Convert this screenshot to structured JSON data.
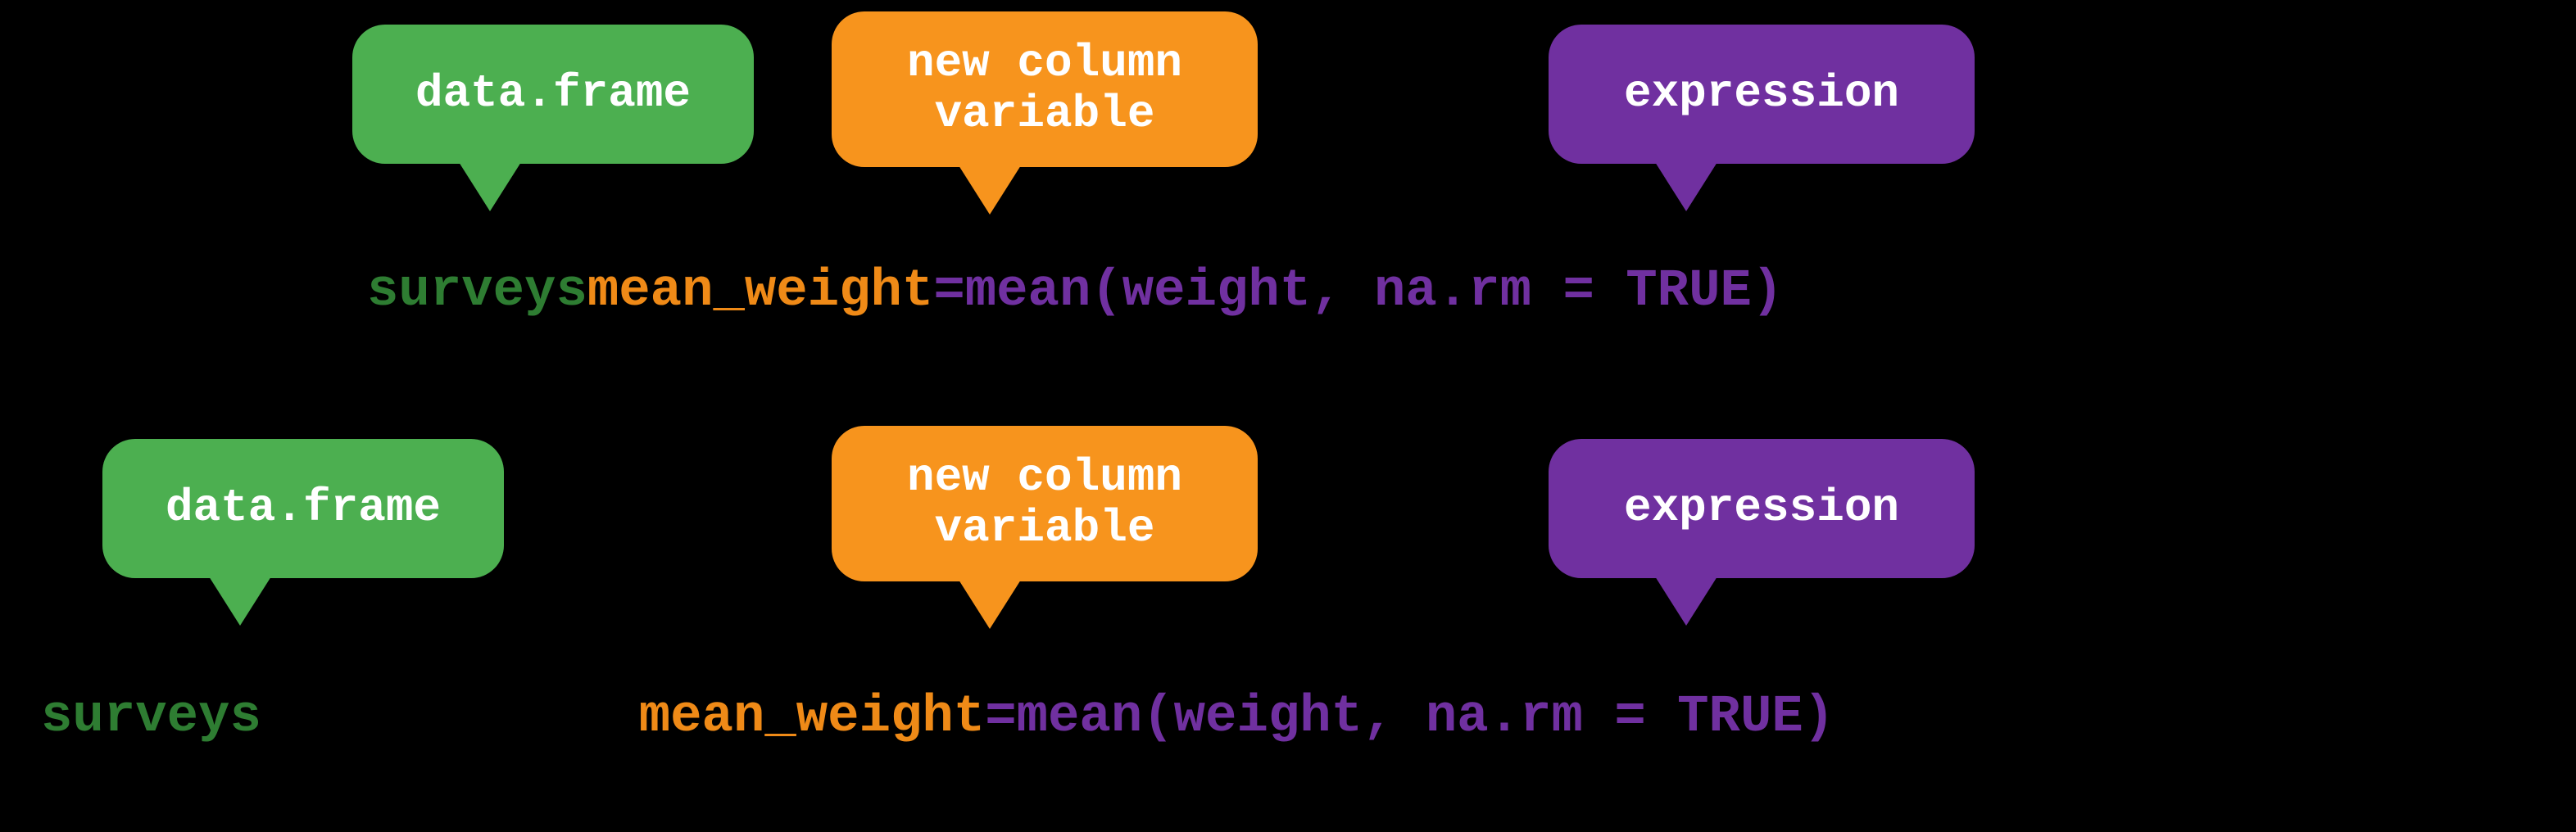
{
  "bubbles": {
    "row1": {
      "df": {
        "label": "data.frame"
      },
      "newcol": {
        "line1": "new column",
        "line2": "variable"
      },
      "expr": {
        "label": "expression"
      }
    },
    "row2": {
      "df": {
        "label": "data.frame"
      },
      "newcol": {
        "line1": "new column",
        "line2": "variable"
      },
      "expr": {
        "label": "expression"
      }
    }
  },
  "code": {
    "row1": {
      "df": "surveys",
      "sep1": " ",
      "newcol": "mean_weight",
      "eq": " = ",
      "expr": "mean(weight, na.rm = TRUE)"
    },
    "row2": {
      "df": "surveys",
      "gap": "            ",
      "newcol": "mean_weight",
      "eq": " = ",
      "expr": "mean(weight, na.rm = TRUE)"
    }
  }
}
